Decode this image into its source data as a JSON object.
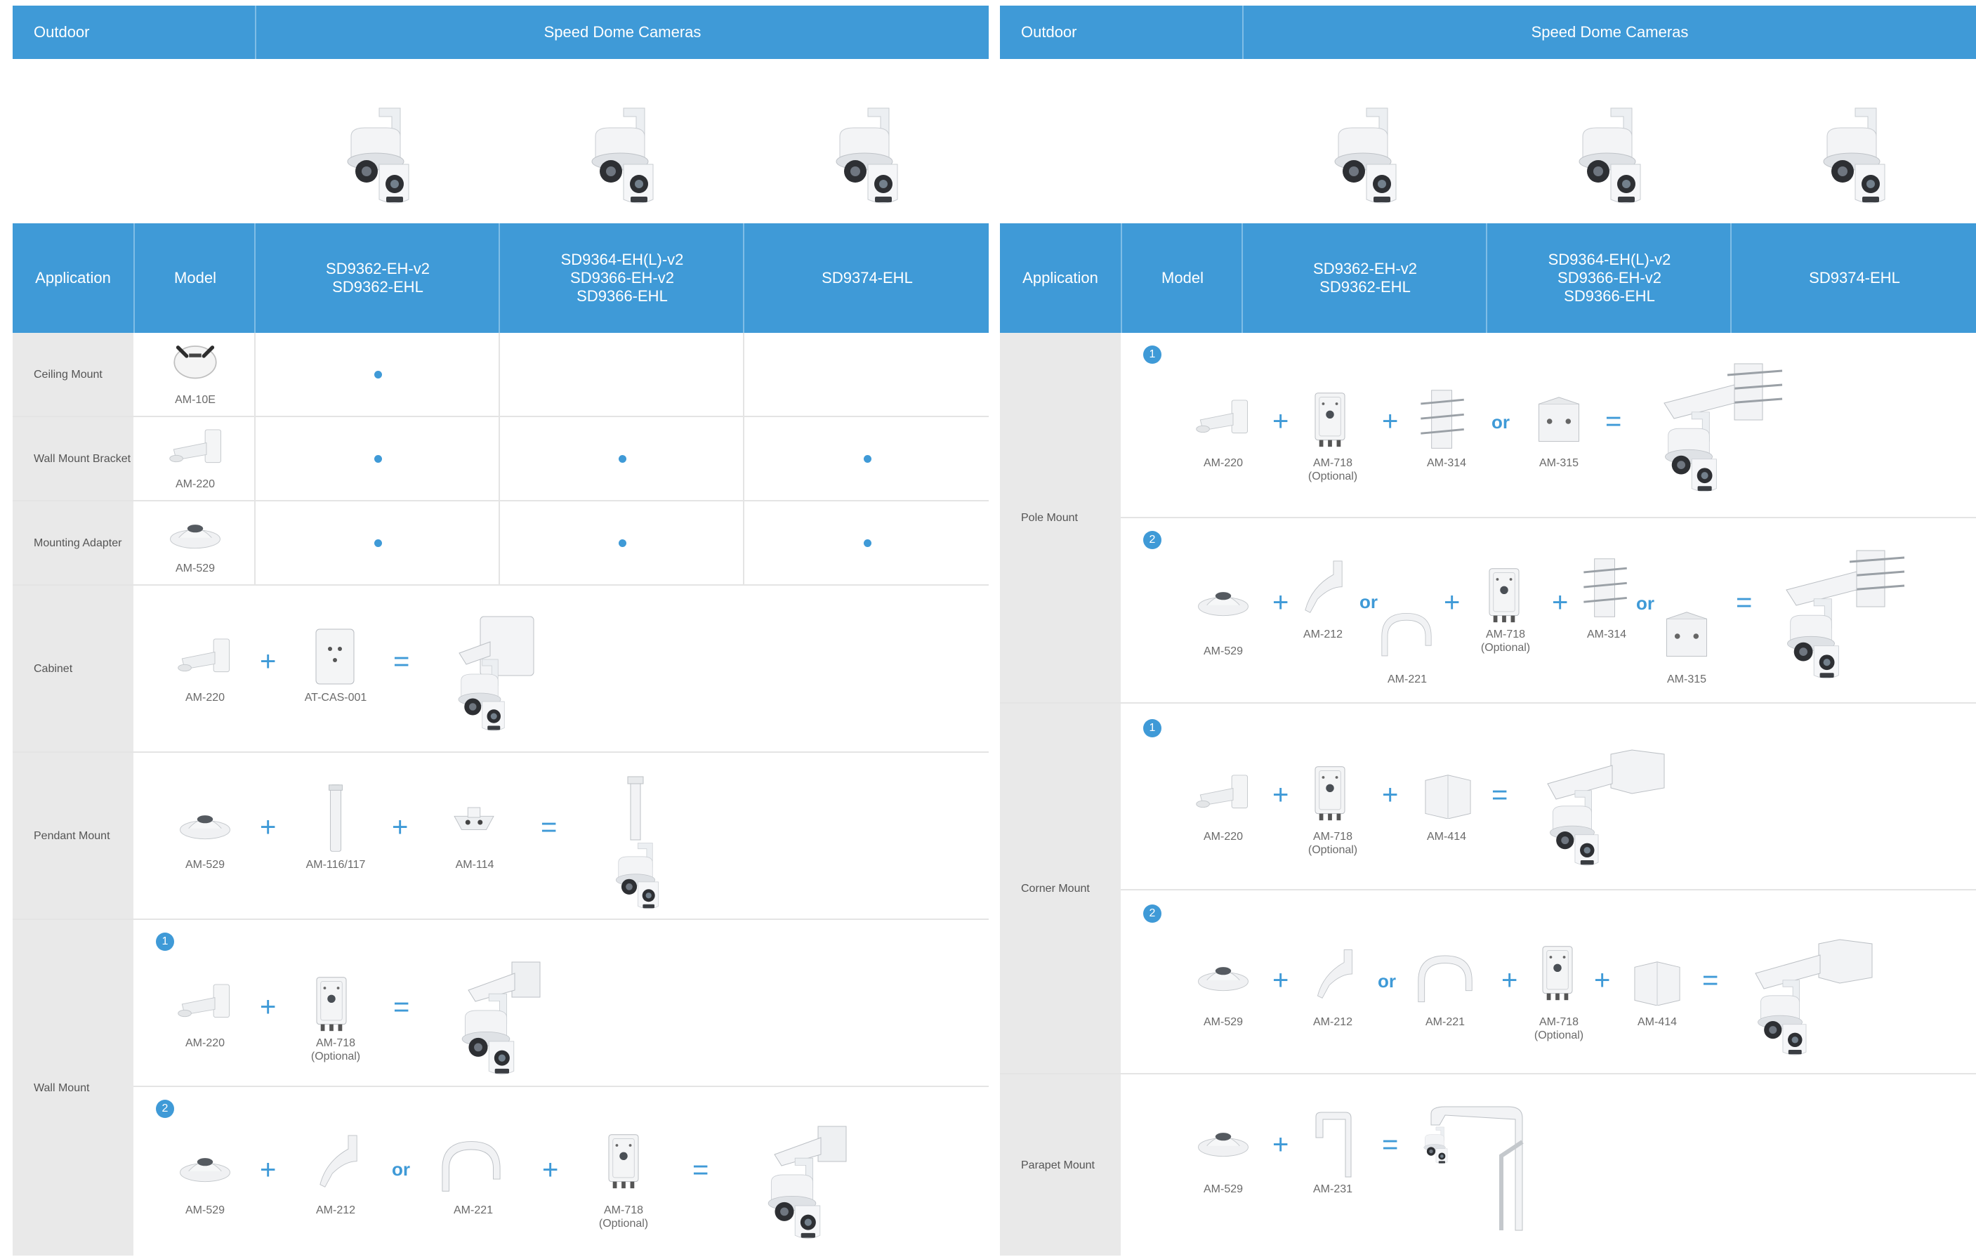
{
  "colors": {
    "accent": "#3f9ad7",
    "app_bg": "#e9e9e9",
    "divider": "#e4e4e4"
  },
  "left": {
    "category": "Outdoor",
    "family": "Speed Dome Cameras",
    "headers": {
      "application": "Application",
      "model": "Model",
      "cols": [
        [
          "SD9362-EH-v2",
          "SD9362-EHL"
        ],
        [
          "SD9364-EH(L)-v2",
          "SD9366-EH-v2",
          "SD9366-EHL"
        ],
        [
          "SD9374-EHL"
        ]
      ]
    },
    "rows": [
      {
        "app": "Ceiling Mount",
        "model": "AM-10E",
        "compat": [
          true,
          false,
          false
        ]
      },
      {
        "app": "Wall Mount Bracket",
        "model": "AM-220",
        "compat": [
          true,
          true,
          true
        ]
      },
      {
        "app": "Mounting Adapter",
        "model": "AM-529",
        "compat": [
          true,
          true,
          true
        ]
      }
    ],
    "cabinet": {
      "app": "Cabinet",
      "parts": [
        "AM-220",
        "AT-CAS-001"
      ]
    },
    "pendant": {
      "app": "Pendant Mount",
      "parts": [
        "AM-529",
        "AM-116/117",
        "AM-114"
      ]
    },
    "wall": {
      "app": "Wall Mount",
      "opt1": {
        "badge": "1",
        "parts": [
          "AM-220",
          "AM-718",
          "(Optional)"
        ]
      },
      "opt2": {
        "badge": "2",
        "parts": [
          "AM-529",
          "AM-212",
          "AM-221",
          "AM-718",
          "(Optional)"
        ]
      }
    }
  },
  "right": {
    "category": "Outdoor",
    "family": "Speed Dome Cameras",
    "headers": {
      "application": "Application",
      "model": "Model",
      "cols": [
        [
          "SD9362-EH-v2",
          "SD9362-EHL"
        ],
        [
          "SD9364-EH(L)-v2",
          "SD9366-EH-v2",
          "SD9366-EHL"
        ],
        [
          "SD9374-EHL"
        ]
      ]
    },
    "pole": {
      "app": "Pole Mount",
      "opt1": {
        "badge": "1",
        "parts": [
          "AM-220",
          "AM-718",
          "(Optional)",
          "AM-314",
          "AM-315"
        ]
      },
      "opt2": {
        "badge": "2",
        "parts": [
          "AM-529",
          "AM-212",
          "AM-221",
          "AM-718",
          "(Optional)",
          "AM-314",
          "AM-315"
        ]
      }
    },
    "corner": {
      "app": "Corner Mount",
      "opt1": {
        "badge": "1",
        "parts": [
          "AM-220",
          "AM-718",
          "(Optional)",
          "AM-414"
        ]
      },
      "opt2": {
        "badge": "2",
        "parts": [
          "AM-529",
          "AM-212",
          "AM-221",
          "AM-718",
          "(Optional)",
          "AM-414"
        ]
      }
    },
    "parapet": {
      "app": "Parapet Mount",
      "parts": [
        "AM-529",
        "AM-231"
      ]
    }
  },
  "ops": {
    "plus": "+",
    "equals": "=",
    "or": "or"
  },
  "icons": [
    "speed-dome-camera-icon",
    "ceiling-mount-icon",
    "wall-bracket-icon",
    "mounting-adapter-icon",
    "junction-box-icon",
    "cabinet-box-icon",
    "pendant-pipe-icon",
    "pendant-cap-icon",
    "gooseneck-arm-icon",
    "curved-arm-icon",
    "pole-mount-icon",
    "corner-mount-icon",
    "parapet-mount-icon"
  ]
}
